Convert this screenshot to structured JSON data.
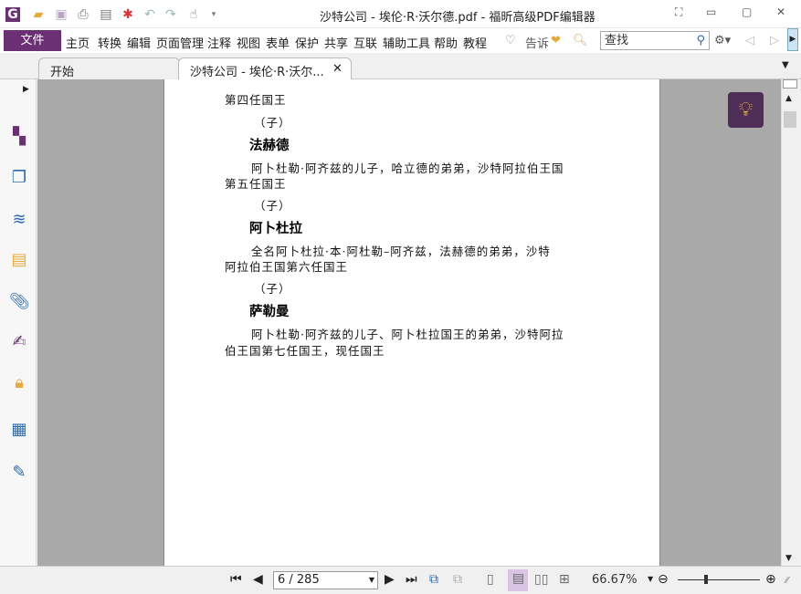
{
  "window": {
    "title": "沙特公司 - 埃伦·R·沃尔德.pdf - 福昕高级PDF编辑器"
  },
  "menu": {
    "file": "文件",
    "items": [
      "主页",
      "转换",
      "编辑",
      "页面管理",
      "注释",
      "视图",
      "表单",
      "保护",
      "共享",
      "互联",
      "辅助工具",
      "帮助",
      "教程"
    ],
    "tell": "告诉",
    "search_placeholder": "查找"
  },
  "tabs": [
    {
      "label": "开始"
    },
    {
      "label": "沙特公司 - 埃伦·R·沃尔..."
    }
  ],
  "document": {
    "lines": [
      {
        "type": "text",
        "text": "第四任国王"
      },
      {
        "type": "sub",
        "text": "（子）"
      },
      {
        "type": "heading",
        "text": "法赫德"
      },
      {
        "type": "para",
        "text": "阿卜杜勒·阿齐兹的儿子，哈立德的弟弟，沙特阿拉伯王国"
      },
      {
        "type": "text",
        "text": "第五任国王"
      },
      {
        "type": "sub",
        "text": "（子）"
      },
      {
        "type": "heading",
        "text": "阿卜杜拉"
      },
      {
        "type": "para",
        "text": "全名阿卜杜拉·本·阿杜勒–阿齐兹，法赫德的弟弟，沙特"
      },
      {
        "type": "text",
        "text": "阿拉伯王国第六任国王"
      },
      {
        "type": "sub",
        "text": "（子）"
      },
      {
        "type": "heading",
        "text": "萨勒曼"
      },
      {
        "type": "para",
        "text": "阿卜杜勒·阿齐兹的儿子、阿卜杜拉国王的弟弟，沙特阿拉"
      },
      {
        "type": "text",
        "text": "伯王国第七任国王，现任国王"
      }
    ]
  },
  "status": {
    "page": "6 / 285",
    "zoom": "66.67%"
  },
  "colors": {
    "accent": "#6b2f74",
    "bulb_bg": "#4e2e57"
  }
}
